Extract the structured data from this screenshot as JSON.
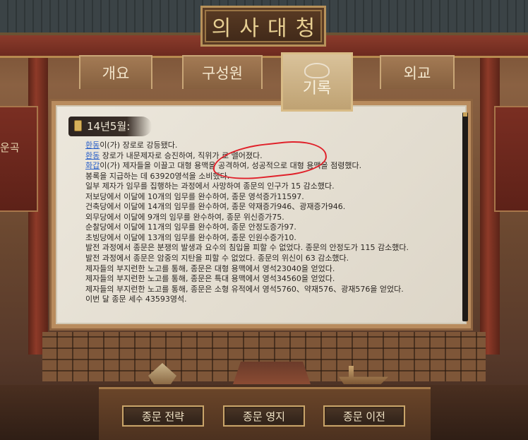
{
  "title": "의사대청",
  "tabs": {
    "overview": "개요",
    "members": "구성원",
    "records": "기록",
    "diplomacy": "외교"
  },
  "side_banner": {
    "left_text": "운곡"
  },
  "record": {
    "date": "14년5월:",
    "lines": [
      {
        "name": "환동",
        "text": "이(가) 장로로 강등됐다."
      },
      {
        "name": "환동",
        "text": " 장로가 내문제자로 승진하여, 직위가 로 뗄어졌다."
      },
      {
        "name": "화갑",
        "text": "이(가) 제자들을 이끌고 대형 용맥을 공격하여, 성공적으로 대형 용맥을 점령했다."
      },
      {
        "text": "봉록을 지급하는 데 63920영석을 소비했다."
      },
      {
        "text": "일부 제자가 임무를 집행하는 과정에서 사망하여 종문의 인구가 15 감소했다."
      },
      {
        "text": "저보당에서 이달에 10개의 임무를 완수하여, 종문 영석증가11597."
      },
      {
        "text": "건축당에서 이달에 14개의 임무를 완수하여, 종문 약재증가946、광재증가946."
      },
      {
        "text": "외무당에서 이달에 9개의 임무를 완수하여, 종문 위신증가75."
      },
      {
        "text": "순찰당에서 이달에 11개의 임무를 완수하여, 종문 안정도증가97."
      },
      {
        "text": "초빙당에서 이달에 13개의 임무를 완수하여, 종문 인원수증가10."
      },
      {
        "text": "발전 과정에서 종문은 분쟁의 발생과 요수의 침입을 피할 수 없었다. 종문의 안정도가 115 감소했다."
      },
      {
        "text": "발전 과정에서 종문은 암중의 지탄을 피할 수 없었다. 종문의 위신이 63 감소했다."
      },
      {
        "text": "제자들의 부지런한 노고를 통해, 종문은 대형 용맥에서 영석23040을 얻었다."
      },
      {
        "text": "제자들의 부지런한 노고를 통해, 종문은 특대 용맥에서 영석34560을 얻었다."
      },
      {
        "text": "제자들의 부지런한 노고를 통해, 종문은 소형 유적에서 영석5760、약재576、광재576을 얻었다."
      },
      {
        "text": "이번 달 종문 세수 43593영석."
      }
    ]
  },
  "buttons": {
    "strategy": "종문 전략",
    "territory": "종문 영지",
    "relocate": "종문 이전"
  },
  "icons": {
    "record_header": "scroll-icon"
  },
  "colors": {
    "name_link": "#2e63c9",
    "annotation": "#e0212a",
    "title_gold": "#e7cf92"
  }
}
